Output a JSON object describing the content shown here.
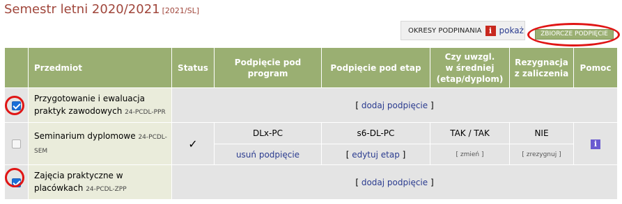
{
  "header": {
    "title": "Semestr letni 2020/2021",
    "code": "[2021/SL]"
  },
  "periods": {
    "label": "OKRESY PODPINANIA",
    "info_icon": "info-icon-red",
    "show_label": "pokaż"
  },
  "summary_button": {
    "label": "ZBIORCZE PODPIĘCIE"
  },
  "table": {
    "headers": {
      "subject": "Przedmiot",
      "status": "Status",
      "program_line1": "Podpięcie pod",
      "program_line2": "program",
      "stage": "Podpięcie pod etap",
      "avg_line1": "Czy uwzgl.",
      "avg_line2": "w średniej",
      "avg_line3": "(etap/dyplom)",
      "resign_line1": "Rezygnacja",
      "resign_line2": "z zaliczenia",
      "help": "Pomoc"
    },
    "rows": [
      {
        "checked": true,
        "name": "Przygotowanie i ewaluacja praktyk zawodowych",
        "code": "24-PCDL-PPR",
        "add_label": "dodaj podpięcie"
      },
      {
        "checked": false,
        "name": "Seminarium dyplomowe",
        "code": "24-PCDL-SEM",
        "status_icon": "checkmark-icon",
        "program": "DLx-PC",
        "stage": "s6-DL-PC",
        "avg": "TAK / TAK",
        "resign": "NIE",
        "remove_label": "usuń podpięcie",
        "edit_stage_label": "edytuj etap",
        "change_label": "zmień",
        "resign_action_label": "zrezygnuj",
        "help_icon": "info-icon-blue"
      },
      {
        "checked": true,
        "name": "Zajęcia praktyczne w placówkach",
        "code": "24-PCDL-ZPP",
        "add_label": "dodaj podpięcie"
      }
    ]
  },
  "colors": {
    "title": "#a0463b",
    "header_bg": "#9aaf72",
    "link": "#2a3b8f",
    "highlight_ring": "#e01515",
    "checkbox": "#1a6fd8"
  }
}
